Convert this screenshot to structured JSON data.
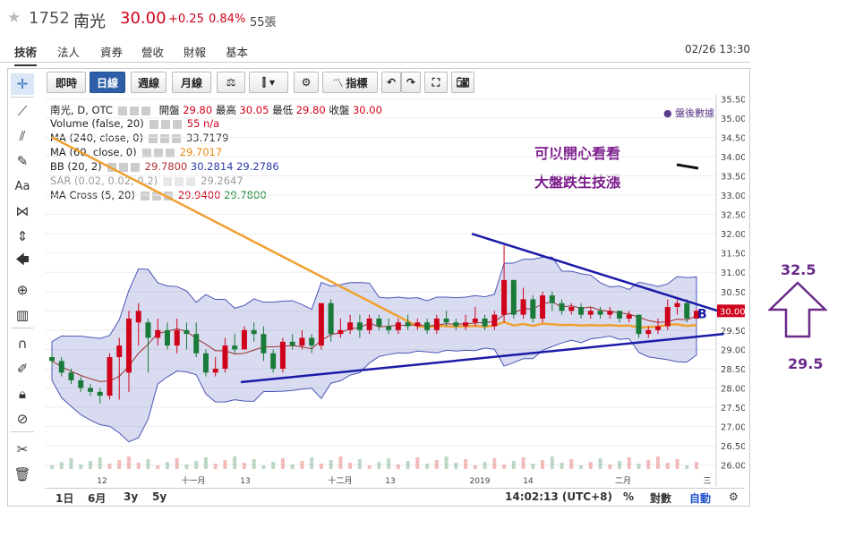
{
  "header": {
    "code": "1752",
    "name": "南光",
    "price": "30.00",
    "change": "+0.25",
    "change_pct": "0.84%",
    "volume": "55張"
  },
  "nav": {
    "tabs": [
      "技術",
      "法人",
      "資券",
      "營收",
      "財報",
      "基本"
    ],
    "active": "技術",
    "datetime": "02/26 13:30"
  },
  "toolbar": {
    "buttons": [
      "即時",
      "日線",
      "週線",
      "月線",
      "指標"
    ],
    "active": "日線"
  },
  "legend": {
    "title": "南光, D, OTC",
    "ohlc_labels": [
      "開盤",
      "最高",
      "最低",
      "收盤"
    ],
    "ohlc_values": [
      "29.80",
      "30.05",
      "29.80",
      "30.00"
    ],
    "volume_label": "Volume (false, 20)",
    "volume_value": "55 n/a",
    "ma240_label": "MA (240, close, 0)",
    "ma240_value": "33.7179",
    "ma60_label": "MA (60, close, 0)",
    "ma60_value": "29.7017",
    "bb_label": "BB (20, 2)",
    "bb_values": [
      "29.7800",
      "30.2814",
      "29.2786"
    ],
    "sar_label": "SAR (0.02, 0.02, 0.2)",
    "sar_value": "29.2647",
    "macross_label": "MA Cross (5, 20)",
    "macross_values": [
      "29.9400",
      "29.7800"
    ],
    "after_hours": "● 盤後數據"
  },
  "annotations": {
    "line1": "可以開心看看",
    "line2": "大盤跌生技漲",
    "marker_b": "B",
    "target_up": "32.5",
    "target_down": "29.5"
  },
  "y_axis": {
    "ticks": [
      "35.50",
      "35.00",
      "34.50",
      "34.00",
      "33.50",
      "33.00",
      "32.50",
      "32.00",
      "31.50",
      "31.00",
      "30.50",
      "30.00",
      "29.50",
      "29.00",
      "28.50",
      "28.00",
      "27.50",
      "27.00",
      "26.50",
      "26.00"
    ],
    "current": "30.00"
  },
  "x_axis": {
    "labels": [
      "12",
      "十一月",
      "13",
      "十二月",
      "13",
      "2019",
      "14",
      "二月",
      "三"
    ]
  },
  "bottom": {
    "ranges": [
      "1日",
      "6月",
      "3y",
      "5y"
    ],
    "time": "14:02:13 (UTC+8)",
    "pct": "%",
    "log": "對數",
    "auto": "自動"
  },
  "chart_data": {
    "type": "candlestick",
    "ylim": [
      25.9,
      35.6
    ],
    "trend_lines": {
      "upper": [
        [
          32.0,
          0.61
        ],
        [
          29.95,
          0.97
        ]
      ],
      "lower": [
        [
          28.15,
          0.28
        ],
        [
          29.4,
          0.97
        ]
      ]
    },
    "candles": [
      [
        28.8,
        28.7,
        28.9,
        28.6
      ],
      [
        28.7,
        28.4,
        28.8,
        28.3
      ],
      [
        28.4,
        28.2,
        28.5,
        28.1
      ],
      [
        28.2,
        28.0,
        28.3,
        27.9
      ],
      [
        28.0,
        27.9,
        28.1,
        27.8
      ],
      [
        27.9,
        27.8,
        28.0,
        27.6
      ],
      [
        27.8,
        28.8,
        28.9,
        27.7
      ],
      [
        28.8,
        29.1,
        29.3,
        27.7
      ],
      [
        28.4,
        29.8,
        30.0,
        27.9
      ],
      [
        29.7,
        30.0,
        30.2,
        29.1
      ],
      [
        29.7,
        29.3,
        29.8,
        28.4
      ],
      [
        29.3,
        29.5,
        29.8,
        29.1
      ],
      [
        29.5,
        29.1,
        29.7,
        29.0
      ],
      [
        29.1,
        29.5,
        29.8,
        28.9
      ],
      [
        29.5,
        29.4,
        29.7,
        29.0
      ],
      [
        29.4,
        28.9,
        29.7,
        28.8
      ],
      [
        28.9,
        28.4,
        29.0,
        28.3
      ],
      [
        28.4,
        28.5,
        28.8,
        28.3
      ],
      [
        28.5,
        29.1,
        29.3,
        28.4
      ],
      [
        29.1,
        29.0,
        29.4,
        28.9
      ],
      [
        29.0,
        29.5,
        29.6,
        29.0
      ],
      [
        29.5,
        29.4,
        29.7,
        29.2
      ],
      [
        29.4,
        28.9,
        29.6,
        28.7
      ],
      [
        28.9,
        28.5,
        29.0,
        28.4
      ],
      [
        28.5,
        29.2,
        29.3,
        28.4
      ],
      [
        29.2,
        29.1,
        29.4,
        29.0
      ],
      [
        29.1,
        29.3,
        29.5,
        29.0
      ],
      [
        29.3,
        29.1,
        29.4,
        28.9
      ],
      [
        29.1,
        30.2,
        30.2,
        29.0
      ],
      [
        30.2,
        29.4,
        30.3,
        29.2
      ],
      [
        29.4,
        29.5,
        29.8,
        29.3
      ],
      [
        29.5,
        29.7,
        29.9,
        29.4
      ],
      [
        29.7,
        29.5,
        29.9,
        29.3
      ],
      [
        29.5,
        29.8,
        29.9,
        29.4
      ],
      [
        29.8,
        29.6,
        29.9,
        29.5
      ],
      [
        29.6,
        29.5,
        29.8,
        29.4
      ],
      [
        29.5,
        29.7,
        29.8,
        29.4
      ],
      [
        29.7,
        29.6,
        29.9,
        29.5
      ],
      [
        29.6,
        29.7,
        29.8,
        29.5
      ],
      [
        29.7,
        29.5,
        29.8,
        29.4
      ],
      [
        29.5,
        29.8,
        29.9,
        29.4
      ],
      [
        29.8,
        29.7,
        30.0,
        29.6
      ],
      [
        29.7,
        29.6,
        29.8,
        29.5
      ],
      [
        29.6,
        29.7,
        29.9,
        29.5
      ],
      [
        29.7,
        29.8,
        30.1,
        29.6
      ],
      [
        29.8,
        29.6,
        29.9,
        29.5
      ],
      [
        29.6,
        29.9,
        30.0,
        29.5
      ],
      [
        29.9,
        30.8,
        31.7,
        29.7
      ],
      [
        30.8,
        29.9,
        30.8,
        29.8
      ],
      [
        29.9,
        30.3,
        30.6,
        29.8
      ],
      [
        30.3,
        29.8,
        30.4,
        29.7
      ],
      [
        29.8,
        30.4,
        30.5,
        29.7
      ],
      [
        30.4,
        30.2,
        30.5,
        30.0
      ],
      [
        30.2,
        30.0,
        30.3,
        29.9
      ],
      [
        30.0,
        30.1,
        30.2,
        29.9
      ],
      [
        30.1,
        29.9,
        30.2,
        29.8
      ],
      [
        29.9,
        30.0,
        30.1,
        29.8
      ],
      [
        30.0,
        29.9,
        30.1,
        29.8
      ],
      [
        29.9,
        30.0,
        30.1,
        29.8
      ],
      [
        30.0,
        29.8,
        30.0,
        29.7
      ],
      [
        29.8,
        29.9,
        30.0,
        29.7
      ],
      [
        29.9,
        29.4,
        29.9,
        29.3
      ],
      [
        29.4,
        29.5,
        29.6,
        29.3
      ],
      [
        29.5,
        29.6,
        29.8,
        29.4
      ],
      [
        29.6,
        30.1,
        30.3,
        29.5
      ],
      [
        30.1,
        30.2,
        30.3,
        29.9
      ],
      [
        30.2,
        29.8,
        30.3,
        29.7
      ],
      [
        29.8,
        30.0,
        30.05,
        29.8
      ]
    ]
  }
}
